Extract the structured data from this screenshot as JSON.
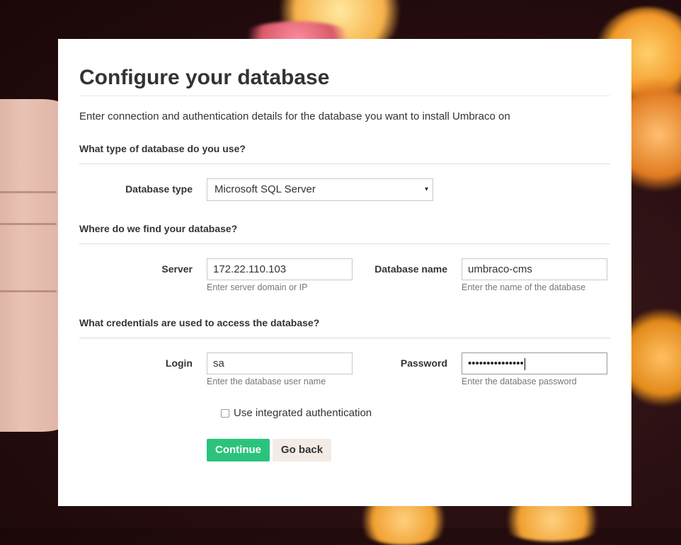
{
  "page": {
    "title": "Configure your database",
    "intro": "Enter connection and authentication details for the database you want to install Umbraco on"
  },
  "sections": {
    "db_type": "What type of database do you use?",
    "location": "Where do we find your database?",
    "credentials": "What credentials are used to access the database?"
  },
  "fields": {
    "database_type": {
      "label": "Database type",
      "value": "Microsoft SQL Server"
    },
    "server": {
      "label": "Server",
      "value": "172.22.110.103",
      "help": "Enter server domain or IP"
    },
    "database_name": {
      "label": "Database name",
      "value": "umbraco-cms",
      "help": "Enter the name of the database"
    },
    "login": {
      "label": "Login",
      "value": "sa",
      "help": "Enter the database user name"
    },
    "password": {
      "label": "Password",
      "value": "•••••••••••••••",
      "help": "Enter the database password"
    }
  },
  "integrated_auth": {
    "label": "Use integrated authentication",
    "checked": false
  },
  "buttons": {
    "continue": "Continue",
    "go_back": "Go back"
  },
  "colors": {
    "accent": "#2bc37c",
    "secondary_button": "#f2ebe6",
    "text": "#333333"
  },
  "icons": {
    "select_caret": "▾"
  }
}
